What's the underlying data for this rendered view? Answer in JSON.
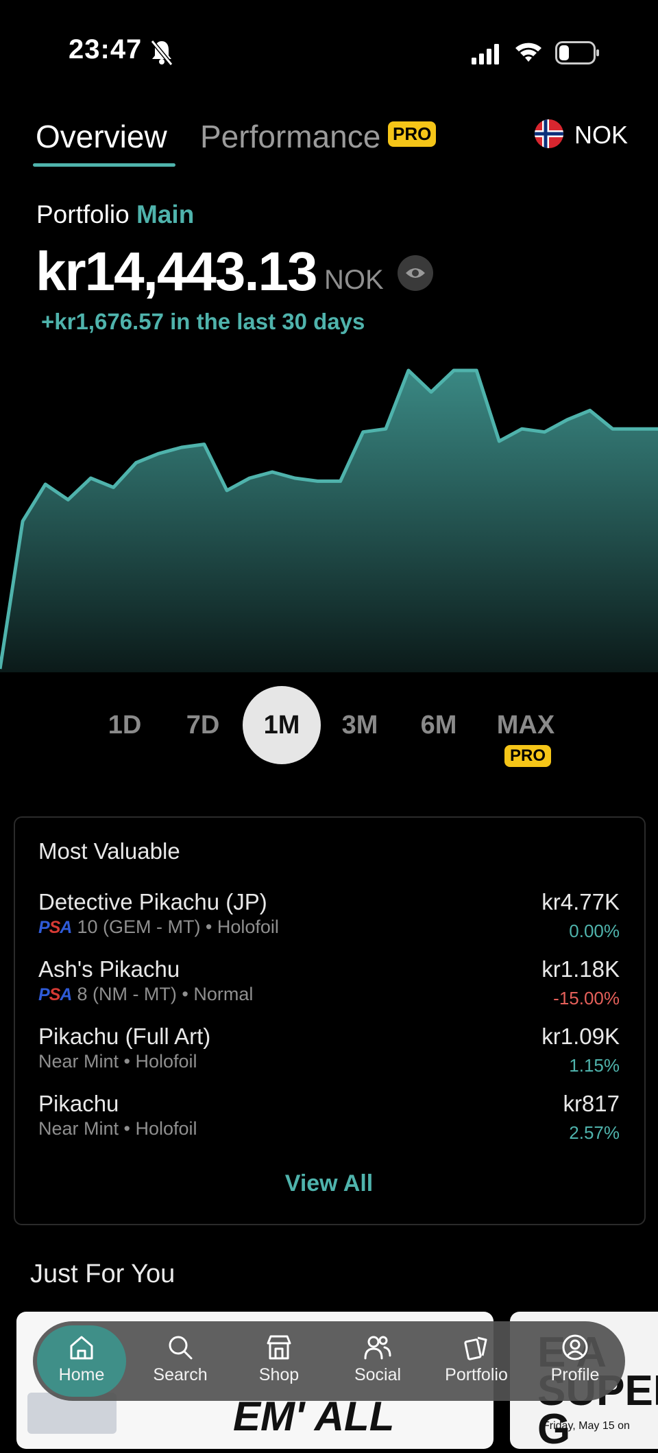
{
  "status_bar": {
    "time": "23:47"
  },
  "tabs": {
    "overview": "Overview",
    "performance": "Performance",
    "performance_badge": "PRO",
    "currency": "NOK"
  },
  "portfolio": {
    "label": "Portfolio",
    "name": "Main",
    "value": "kr14,443.13",
    "currency": "NOK",
    "change": "+kr1,676.57 in the last 30 days"
  },
  "chart_data": {
    "type": "area",
    "values": [
      0,
      48,
      60,
      55,
      62,
      59,
      67,
      70,
      72,
      73,
      58,
      62,
      64,
      62,
      61,
      61,
      77,
      78,
      97,
      90,
      97,
      97,
      74,
      78,
      77,
      81,
      84,
      78,
      78,
      78
    ],
    "color": "#4fb3ac"
  },
  "ranges": [
    "1D",
    "7D",
    "1M",
    "3M",
    "6M",
    "MAX"
  ],
  "selected_range": "1M",
  "range_pro_badge": "PRO",
  "most_valuable": {
    "title": "Most Valuable",
    "items": [
      {
        "name": "Detective Pikachu (JP)",
        "grade_logo": "PSA",
        "details": "10 (GEM - MT) • Holofoil",
        "value": "kr4.77K",
        "change": "0.00%"
      },
      {
        "name": "Ash's Pikachu",
        "grade_logo": "PSA",
        "details": "8 (NM - MT) • Normal",
        "value": "kr1.18K",
        "change": "-15.00%"
      },
      {
        "name": "Pikachu (Full Art)",
        "details": "Near Mint • Holofoil",
        "value": "kr1.09K",
        "change": "1.15%"
      },
      {
        "name": "Pikachu",
        "details": "Near Mint • Holofoil",
        "value": "kr817",
        "change": "2.57%"
      }
    ],
    "view_all": "View All"
  },
  "just_for_you": {
    "title": "Just For You",
    "card1_text": "EM' ALL",
    "card2_text": "E A SUPER G",
    "card2_date": "Friday, May 15 on"
  },
  "nav": {
    "home": "Home",
    "search": "Search",
    "shop": "Shop",
    "social": "Social",
    "portfolio": "Portfolio",
    "profile": "Profile"
  },
  "colors": {
    "accent": "#4fb3ac",
    "pro": "#f5c518",
    "negative": "#e5605a"
  }
}
